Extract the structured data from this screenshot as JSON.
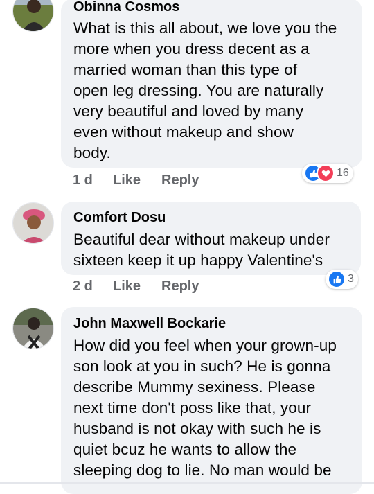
{
  "comments": [
    {
      "author": "Obinna Cosmos",
      "lines": [
        "What is this all about, we love you the",
        "more when you dress decent as a",
        "married woman than this type of",
        "open leg dressing. You are naturally",
        "very beautiful and loved by many",
        "even without makeup and show",
        "body."
      ],
      "time": "1 d",
      "like": "Like",
      "reply": "Reply",
      "reaction_count": "16",
      "reactions": [
        "like-icon",
        "love-icon"
      ]
    },
    {
      "author": "Comfort Dosu",
      "lines": [
        "Beautiful dear without makeup under",
        "sixteen keep it up happy Valentine's"
      ],
      "time": "2 d",
      "like": "Like",
      "reply": "Reply",
      "reaction_count": "3",
      "reactions": [
        "like-icon"
      ]
    },
    {
      "author": "John Maxwell Bockarie",
      "lines": [
        "How did you feel when your grown-up",
        "son look at you in such? He is gonna",
        "describe Mummy sexiness. Please",
        "next time don't poss like that, your",
        "husband is not okay with such he is",
        "quiet bcuz he wants to allow the",
        "sleeping dog to lie. No man would be"
      ]
    }
  ],
  "colors": {
    "bubble": "#f0f2f5",
    "meta": "#65676b",
    "like_blue": "#1877f2",
    "love_red": "#f33e58"
  }
}
